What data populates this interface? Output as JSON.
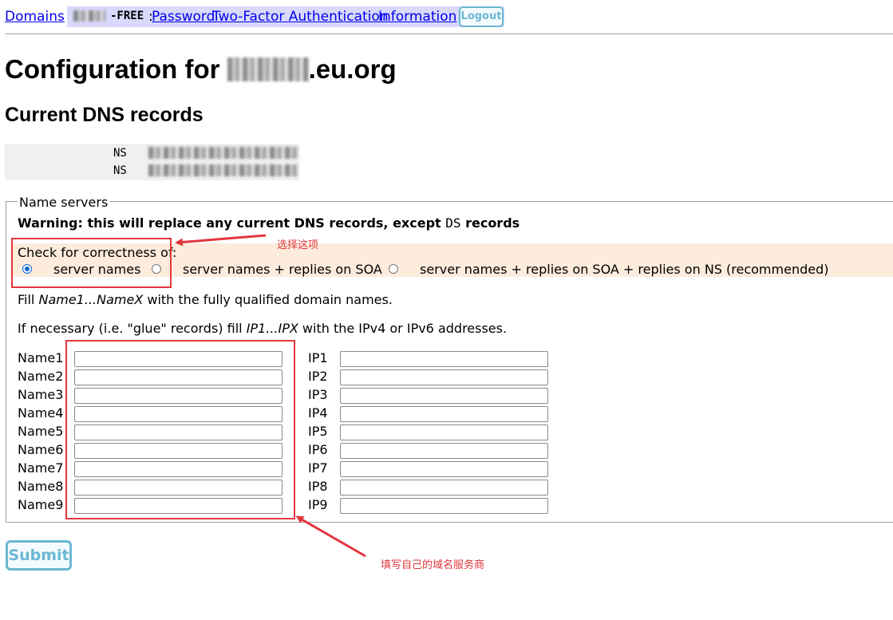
{
  "nav": {
    "domains_link": "Domains",
    "free_tag": "-FREE",
    "colon": ":",
    "password_link": "Password",
    "twofa_link": "Two-Factor Authentication",
    "information_link": "Information",
    "logout_button": "Logout"
  },
  "page": {
    "title_prefix": "Configuration for",
    "title_suffix": ".eu.org",
    "current_dns_heading": "Current DNS records"
  },
  "dns_records": [
    {
      "type": "NS"
    },
    {
      "type": "NS"
    }
  ],
  "form": {
    "legend": "Name servers",
    "warning_before": "Warning: this will replace any current DNS records, except ",
    "warning_code": "DS",
    "warning_after": " records",
    "check_label": "Check for correctness of:",
    "check_options": [
      {
        "label": "server names",
        "selected": true
      },
      {
        "label": "server names + replies on SOA",
        "selected": false
      },
      {
        "label": "server names + replies on SOA + replies on NS (recommended)",
        "selected": false
      }
    ],
    "instruction_1": {
      "before": "Fill ",
      "em": "Name1...NameX",
      "after": " with the fully qualified domain names."
    },
    "instruction_2": {
      "before": "If necessary (i.e. \"glue\" records) fill ",
      "em": "IP1...IPX",
      "after": " with the IPv4 or IPv6 addresses."
    },
    "rows": [
      {
        "name_label": "Name1",
        "ip_label": "IP1",
        "name_value": "",
        "ip_value": ""
      },
      {
        "name_label": "Name2",
        "ip_label": "IP2",
        "name_value": "",
        "ip_value": ""
      },
      {
        "name_label": "Name3",
        "ip_label": "IP3",
        "name_value": "",
        "ip_value": ""
      },
      {
        "name_label": "Name4",
        "ip_label": "IP4",
        "name_value": "",
        "ip_value": ""
      },
      {
        "name_label": "Name5",
        "ip_label": "IP5",
        "name_value": "",
        "ip_value": ""
      },
      {
        "name_label": "Name6",
        "ip_label": "IP6",
        "name_value": "",
        "ip_value": ""
      },
      {
        "name_label": "Name7",
        "ip_label": "IP7",
        "name_value": "",
        "ip_value": ""
      },
      {
        "name_label": "Name8",
        "ip_label": "IP8",
        "name_value": "",
        "ip_value": ""
      },
      {
        "name_label": "Name9",
        "ip_label": "IP9",
        "name_value": "",
        "ip_value": ""
      }
    ],
    "submit_button": "Submit"
  },
  "annotations": {
    "select_option": "选择这项",
    "fill_servers": "填写自己的域名服务商",
    "color": "#e2373d"
  },
  "colors": {
    "link": "#0000ee",
    "nav_band": "#d9d9fb",
    "check_band": "#fdebdc",
    "button_accent": "#6ab7d3",
    "radio_selected": "#0a68d8"
  }
}
